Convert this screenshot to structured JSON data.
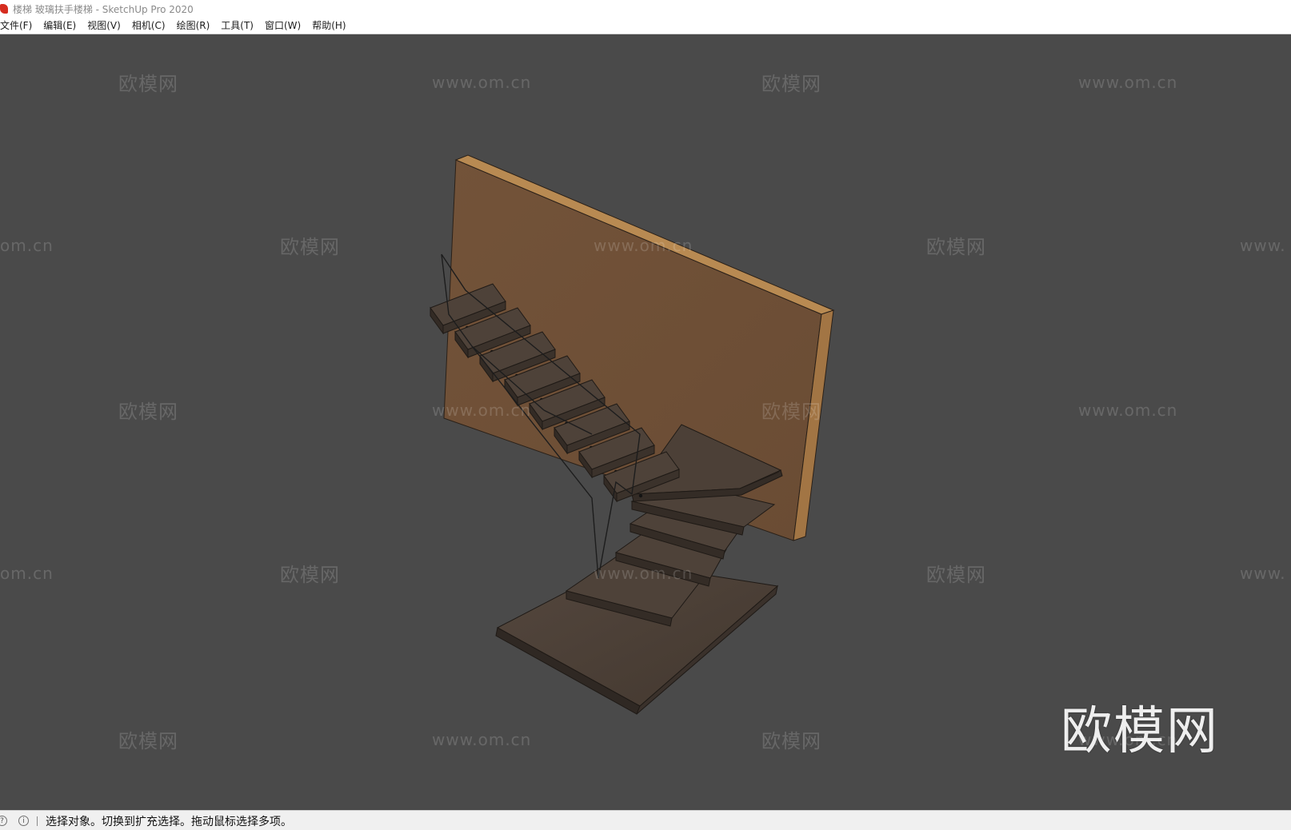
{
  "window": {
    "title": "楼梯 玻璃扶手楼梯 - SketchUp Pro 2020"
  },
  "menu": [
    {
      "id": "file",
      "label": "文件(F)"
    },
    {
      "id": "edit",
      "label": "编辑(E)"
    },
    {
      "id": "view",
      "label": "视图(V)"
    },
    {
      "id": "camera",
      "label": "相机(C)"
    },
    {
      "id": "draw",
      "label": "绘图(R)"
    },
    {
      "id": "tools",
      "label": "工具(T)"
    },
    {
      "id": "window",
      "label": "窗口(W)"
    },
    {
      "id": "help",
      "label": "帮助(H)"
    }
  ],
  "watermarks": {
    "brand": "欧模网",
    "url": "www.om.cn",
    "url_fragment_left": "om.cn",
    "url_fragment_right": "www."
  },
  "status": {
    "message": "选择对象。切换到扩充选择。拖动鼠标选择多项。",
    "info_icon": "i"
  },
  "colors": {
    "viewport_bg": "#4a4a4a",
    "wall": "#6e5038",
    "wall_edge": "#a87a46",
    "tread": "#4b4039",
    "tread_side": "#3a312b"
  },
  "icons": [
    "sketchup-logo-icon",
    "geo-location-icon",
    "info-icon"
  ]
}
